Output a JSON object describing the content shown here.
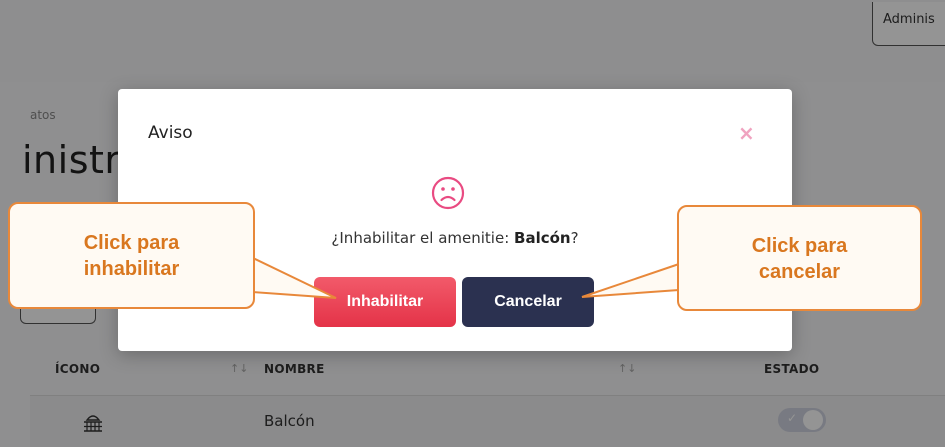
{
  "header": {
    "admin_button_label": "Adminis"
  },
  "page": {
    "breadcrumb": "atos",
    "title": "inistro"
  },
  "table": {
    "columns": [
      "ÍCONO",
      "NOMBRE",
      "ESTADO"
    ],
    "rows": [
      {
        "name": "Balcón",
        "icon": "balcony-icon",
        "estado_enabled": true
      }
    ]
  },
  "modal": {
    "title": "Aviso",
    "close_label": "×",
    "icon": "sad-face-icon",
    "message_prefix": "¿Inhabilitar el amenitie: ",
    "message_item": "Balcón",
    "message_suffix": "?",
    "confirm_label": "Inhabilitar",
    "cancel_label": "Cancelar"
  },
  "callouts": {
    "left": {
      "line1": "Click para",
      "line2": "inhabilitar"
    },
    "right": {
      "line1": "Click para",
      "line2": "cancelar"
    }
  },
  "colors": {
    "danger": "#e43348",
    "cancel": "#2b3150",
    "callout_border": "#e8883a",
    "callout_text": "#d9771f",
    "close_icon": "#f0a3c0",
    "face_icon": "#e94b82"
  }
}
